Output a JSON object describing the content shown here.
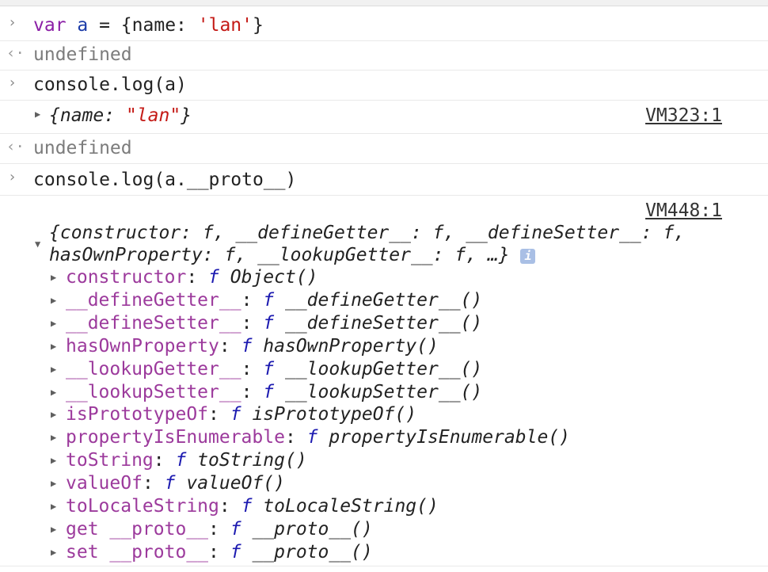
{
  "console": {
    "prompt_glyph": "›",
    "result_glyph": "‹·",
    "input1": {
      "kw": "var",
      "name": "a",
      "eq": " = {name: ",
      "str": "'lan'",
      "close": "}"
    },
    "out1": "undefined",
    "input2": "console.log(a)",
    "log1": {
      "open": "{name: ",
      "str": "\"lan\"",
      "close": "}",
      "source": "VM323:1"
    },
    "out2": "undefined",
    "input3": "console.log(a.__proto__)",
    "log2": {
      "source": "VM448:1",
      "summary_line1": "{constructor: f, __defineGetter__: f, __defineSetter__: f,",
      "summary_line2": "hasOwnProperty: f, __lookupGetter__: f, …}",
      "info_icon": "i",
      "properties": [
        {
          "name": "constructor",
          "f": "f",
          "value": "Object()"
        },
        {
          "name": "__defineGetter__",
          "f": "f",
          "value": "__defineGetter__()"
        },
        {
          "name": "__defineSetter__",
          "f": "f",
          "value": "__defineSetter__()"
        },
        {
          "name": "hasOwnProperty",
          "f": "f",
          "value": "hasOwnProperty()"
        },
        {
          "name": "__lookupGetter__",
          "f": "f",
          "value": "__lookupGetter__()"
        },
        {
          "name": "__lookupSetter__",
          "f": "f",
          "value": "__lookupSetter__()"
        },
        {
          "name": "isPrototypeOf",
          "f": "f",
          "value": "isPrototypeOf()"
        },
        {
          "name": "propertyIsEnumerable",
          "f": "f",
          "value": "propertyIsEnumerable()"
        },
        {
          "name": "toString",
          "f": "f",
          "value": "toString()"
        },
        {
          "name": "valueOf",
          "f": "f",
          "value": "valueOf()"
        },
        {
          "name": "toLocaleString",
          "f": "f",
          "value": "toLocaleString()"
        },
        {
          "name": "get __proto__",
          "f": "f",
          "value": "__proto__()"
        },
        {
          "name": "set __proto__",
          "f": "f",
          "value": "__proto__()"
        }
      ]
    }
  },
  "colors": {
    "keyword": "#8b1fa6",
    "variable": "#1b3ba8",
    "string": "#c41a16",
    "property": "#9c3a9c",
    "function_keyword": "#1c1ab0",
    "muted": "#7c7c7c"
  }
}
